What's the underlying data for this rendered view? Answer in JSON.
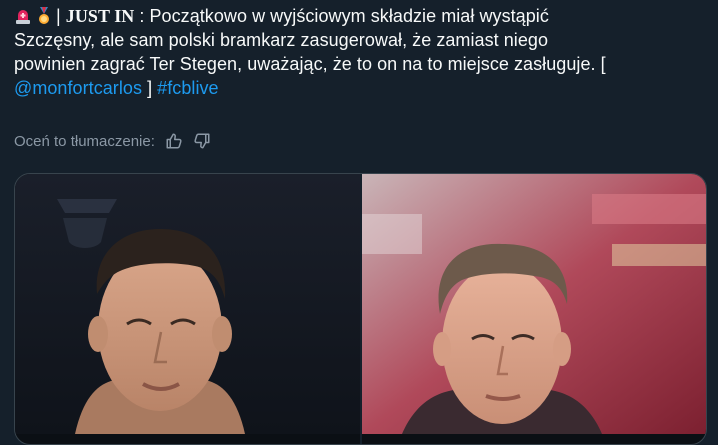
{
  "tweet": {
    "line1_label": "| ",
    "line1_bold": "JUST IN",
    "line1_rest": " : Początkowo w wyjściowym składzie miał wystąpić",
    "line2": "Szczęsny, ale sam polski bramkarz zasugerował, że zamiast niego",
    "line3": "powinien zagrać Ter Stegen, uważając, że to on na to miejsce zasługuje. [",
    "mention": "@monfortcarlos",
    "bracket_close": " ] ",
    "hashtag": "#fcblive",
    "emojis": [
      "rotating-light",
      "medal"
    ]
  },
  "translation_rating": {
    "label": "Oceń to tłumaczenie:",
    "thumbs_up": "thumbs-up-icon",
    "thumbs_down": "thumbs-down-icon"
  },
  "media": {
    "count": 2,
    "photos": [
      "wojciech-szczesny-photo",
      "ter-stegen-photo"
    ]
  },
  "colors": {
    "background": "#15202b",
    "text": "#f7f9f9",
    "link": "#1d9bf0",
    "secondary": "#8b98a5"
  }
}
